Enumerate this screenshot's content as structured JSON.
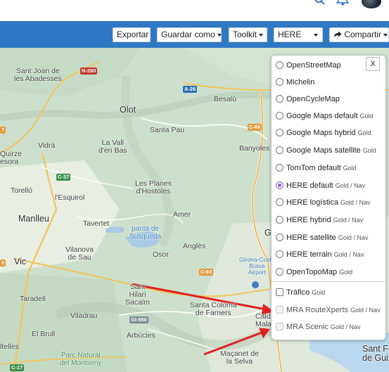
{
  "colors": {
    "toolbar": "#2f78c4",
    "accent_icon": "#2f78c4",
    "radio_selected": "#8b5ac8",
    "arrow": "#e02020"
  },
  "header": {
    "icons": [
      "search-icon",
      "bell-icon",
      "avatar"
    ]
  },
  "toolbar": {
    "export_label": "Exportar",
    "save_as_label": "Guardar como",
    "toolkit_label": "Toolkit",
    "map_provider_value": "HERE",
    "share_label": "Compartir"
  },
  "map": {
    "places": {
      "sant_joan": "Sant Joan de\nles Abadesses",
      "olot": "Olot",
      "besalu": "Besalú",
      "santa_pau": "Santa Pau",
      "la_vall": "La Vall\nd'en Bas",
      "vidra": "Vidrà",
      "quirze": "Quirze\nesora",
      "banyoles": "Banyoles",
      "torello": "Torelló",
      "esquirol": "l'Esquirol",
      "les_planes": "Les Planes\nd'Hostoles",
      "manlleu": "Manlleu",
      "tavertet": "Tavertet",
      "amer": "Amer",
      "pantà": "panta de\nSusqueda",
      "vilanova": "Vilanova\nde Sau",
      "osor": "Osor",
      "angles": "Anglès",
      "girona_partial": "G",
      "vic": "Vic",
      "girona_costa": "Girona-Costa\nBrava\nAirport",
      "sant_hilari": "Sant\nHilari\nSacalm",
      "taradell": "Taradell",
      "santa_coloma": "Santa Coloma\nde Farners",
      "viladrau": "Viladrau",
      "caldes": "Cald\nMala",
      "el_brull": "El Brull",
      "arbucies": "Arbúcies",
      "parc": "Parc Natural\ndel Montseny",
      "massanet": "Maçanet de\nla Selva",
      "sant_feliu": "Sant Fe\nde Guix",
      "ltelles": "ltelles"
    },
    "shields": {
      "n260": "N-260",
      "a26": "A-26",
      "c66": "C-66",
      "c37": "C-37",
      "c63": "C-63",
      "gi550": "GI-550",
      "c17": "C-17",
      "left1": "0",
      "left2": "7"
    }
  },
  "layers": {
    "close_label": "X",
    "base": [
      {
        "name": "OpenStreetMap",
        "tag": "",
        "selected": false
      },
      {
        "name": "Michelin",
        "tag": "",
        "selected": false
      },
      {
        "name": "OpenCycleMap",
        "tag": "",
        "selected": false
      },
      {
        "name": "Google Maps default",
        "tag": "Gold",
        "selected": false
      },
      {
        "name": "Google Maps hybrid",
        "tag": "Gold",
        "selected": false
      },
      {
        "name": "Google Maps satellite",
        "tag": "Gold",
        "selected": false
      },
      {
        "name": "TomTom default",
        "tag": "Gold",
        "selected": false
      },
      {
        "name": "HERE default",
        "tag": "Gold / Nav",
        "selected": true
      },
      {
        "name": "HERE logística",
        "tag": "Gold / Nav",
        "selected": false
      },
      {
        "name": "HERE hybrid",
        "tag": "Gold / Nav",
        "selected": false
      },
      {
        "name": "HERE satellite",
        "tag": "Gold / Nav",
        "selected": false
      },
      {
        "name": "HERE terrain",
        "tag": "Gold / Nav",
        "selected": false
      },
      {
        "name": "OpenTopoMap",
        "tag": "Gold",
        "selected": false
      }
    ],
    "overlays": [
      {
        "name": "Tráfico",
        "tag": "Gold",
        "checked": false,
        "disabled": false
      },
      {
        "name": "MRA RouteXperts",
        "tag": "Gold / Nav",
        "checked": false,
        "disabled": true
      },
      {
        "name": "MRA Scenic",
        "tag": "Gold / Nav",
        "checked": false,
        "disabled": true
      }
    ]
  }
}
